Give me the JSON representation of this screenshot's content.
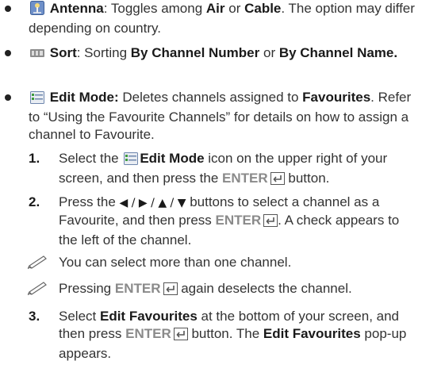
{
  "antenna": {
    "icon": "antenna-icon",
    "title": "Antenna",
    "t1": ": Toggles among ",
    "air": "Air",
    "t2": " or ",
    "cable": "Cable",
    "t3": ". The option may differ depending on country."
  },
  "sort": {
    "icon": "sort-icon",
    "title": "Sort",
    "t1": ": Sorting ",
    "by_number": "By Channel Number",
    "t2": " or ",
    "by_name": "By Channel Name."
  },
  "edit_mode": {
    "icon": "edit-mode-icon",
    "title": "Edit Mode:",
    "t1": " Deletes channels assigned to ",
    "favourites": "Favourites",
    "t2": ". Refer to “Using the Favourite Channels” for details on how to assign a channel to Favourite."
  },
  "steps": [
    {
      "number": "1.",
      "a": "Select the ",
      "bold": "Edit Mode",
      "b": " icon on the upper right of your screen, and then press the ",
      "enter": "ENTER",
      "c": " button."
    },
    {
      "number": "2.",
      "a": "Press the ",
      "arrows": "◀ / ▶ / ▲ / ▼",
      "b": " buttons to select a channel as a Favourite, and then press ",
      "enter": "ENTER",
      "c": ". A check appears to the left of the channel."
    },
    {
      "number": "3.",
      "a": "Select ",
      "bold": "Edit Favourites",
      "b": " at the bottom of your screen, and then press ",
      "enter": "ENTER",
      "c": " button. The ",
      "bold2": "Edit Favourites",
      "d": " pop-up appears."
    }
  ],
  "notes": [
    {
      "icon": "note-pencil-icon",
      "text": "You can select more than one channel."
    },
    {
      "icon": "note-pencil-icon",
      "a": "Pressing ",
      "enter": "ENTER",
      "b": " again deselects the channel."
    }
  ],
  "colors": {
    "bold_text": "#1a1a1a",
    "enter_text": "#8a8a8a",
    "body_text": "#333333"
  }
}
